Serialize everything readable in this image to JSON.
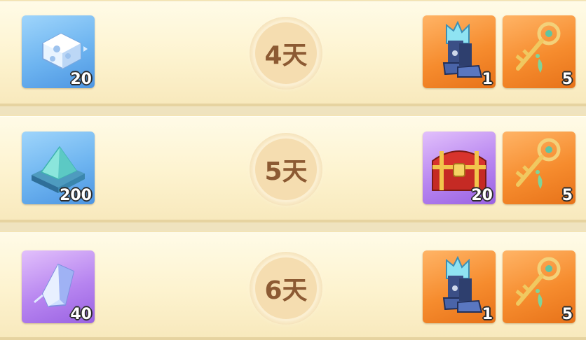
{
  "rows": [
    {
      "day": "4天",
      "left_item": {
        "icon": "puzzle-cube-icon",
        "qty": "20"
      },
      "right_items": [
        {
          "icon": "blue-boots-icon",
          "qty": "1"
        },
        {
          "icon": "golden-key-icon",
          "qty": "5"
        }
      ]
    },
    {
      "day": "5天",
      "left_item": {
        "icon": "teal-pyramid-icon",
        "qty": "200"
      },
      "right_items": [
        {
          "icon": "red-treasure-chest-icon",
          "qty": "20"
        },
        {
          "icon": "golden-key-icon",
          "qty": "5"
        }
      ]
    },
    {
      "day": "6天",
      "left_item": {
        "icon": "purple-crystal-icon",
        "qty": "40"
      },
      "right_items": [
        {
          "icon": "blue-boots-icon",
          "qty": "1"
        },
        {
          "icon": "golden-key-icon",
          "qty": "5"
        }
      ]
    }
  ],
  "colors": {
    "row_background": "#fdf3cf",
    "day_text": "#8c5a33",
    "tile_blue": "#6db4f0",
    "tile_purple": "#b785f0",
    "tile_orange": "#f68c2e"
  }
}
